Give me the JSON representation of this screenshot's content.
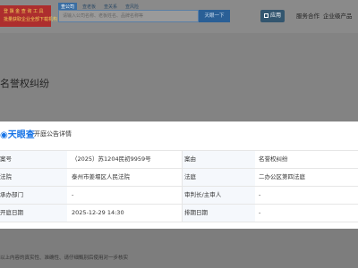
{
  "header": {
    "promo_lines": [
      "登 飘 金 查 询 工 具",
      "批量获取企业全部下载机构"
    ],
    "search_tabs": [
      "查公司",
      "查老板",
      "查关系",
      "查风险"
    ],
    "search_placeholder": "请输入公司名称、老板姓名、品牌名称等",
    "search_button": "天眼一下",
    "app_button": "应用",
    "nav_items": [
      "服务合作",
      "企业级产品"
    ]
  },
  "page": {
    "title": "名誉权纠纷"
  },
  "modal": {
    "logo_text": "天眼查",
    "subtitle": "开庭公告详情",
    "rows": [
      {
        "label": "案号",
        "value": "（2025）苏1204民初9959号",
        "label2": "案由",
        "value2": "名誉权纠纷"
      },
      {
        "label": "法院",
        "value": "泰州市姜堰区人民法院",
        "label2": "法庭",
        "value2": "二办公区第四法庭"
      },
      {
        "label": "承办部门",
        "value": "-",
        "label2": "审判长/主审人",
        "value2": "-"
      },
      {
        "label": "开庭日期",
        "value": "2025-12-29 14:30",
        "label2": "排期日期",
        "value2": "-"
      }
    ]
  },
  "footer": {
    "disclaimer": "以上内容的真实性、准确性、请仔细甄别后使用对一步核实"
  },
  "colors": {
    "accent": "#1673e6",
    "promo": "#ad2e2e",
    "search_button": "#2a5f96"
  }
}
